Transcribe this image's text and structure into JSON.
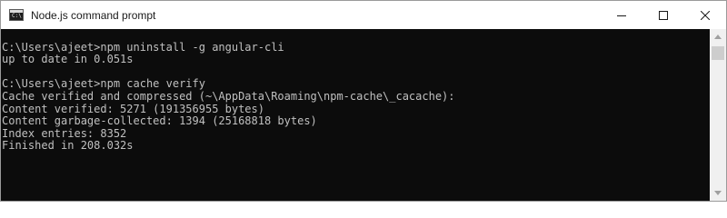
{
  "window": {
    "title": "Node.js command prompt",
    "icon": "console-icon",
    "controls": [
      "minimize-icon",
      "maximize-icon",
      "close-icon"
    ]
  },
  "console": {
    "background": "#0c0c0c",
    "foreground": "#c0c0c0",
    "lines": [
      "",
      "C:\\Users\\ajeet>npm uninstall -g angular-cli",
      "up to date in 0.051s",
      "",
      "C:\\Users\\ajeet>npm cache verify",
      "Cache verified and compressed (~\\AppData\\Roaming\\npm-cache\\_cacache):",
      "Content verified: 5271 (191356955 bytes)",
      "Content garbage-collected: 1394 (25168818 bytes)",
      "Index entries: 8352",
      "Finished in 208.032s",
      "",
      ""
    ]
  },
  "scrollbar": {
    "position": 0
  }
}
